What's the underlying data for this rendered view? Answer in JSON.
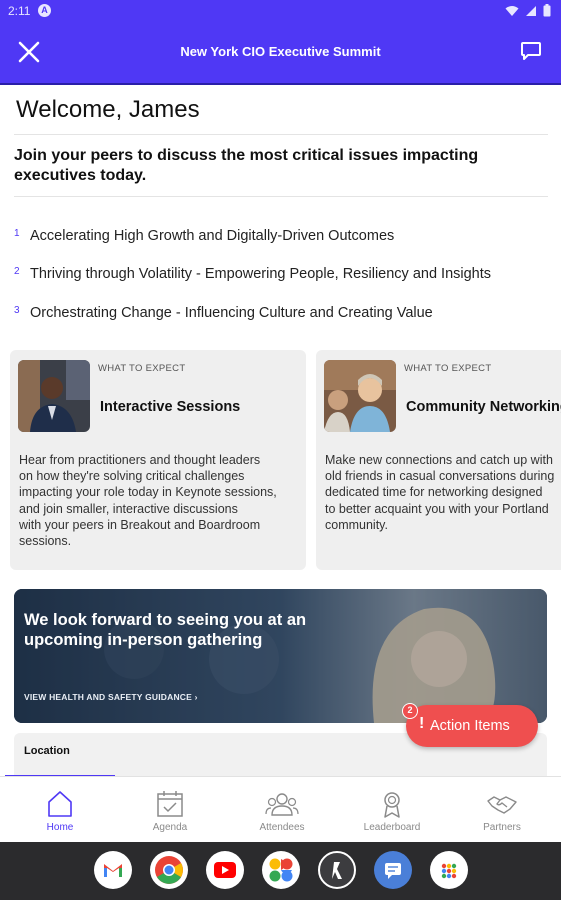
{
  "status_bar": {
    "time": "2:11",
    "badge": "A"
  },
  "header": {
    "title": "New York CIO Executive Summit",
    "close_icon": "close-icon",
    "chat_icon": "chat-icon",
    "color": "#4f38f5"
  },
  "welcome": "Welcome, James",
  "intro": "Join your peers to discuss the most critical issues impacting executives today.",
  "topics": [
    {
      "num": "1",
      "text": "Accelerating High Growth and Digitally-Driven Outcomes"
    },
    {
      "num": "2",
      "text": "Thriving through Volatility - Empowering People, Resiliency and Insights"
    },
    {
      "num": "3",
      "text": "Orchestrating Change - Influencing Culture and Creating Value"
    }
  ],
  "cards": [
    {
      "kicker": "WHAT TO EXPECT",
      "title": "Interactive Sessions",
      "body": [
        "Hear from practitioners and thought leaders",
        "on how they're solving critical challenges",
        "impacting your role today in Keynote sessions,",
        "and join smaller, interactive discussions",
        "with your peers in Breakout and Boardroom",
        "sessions."
      ]
    },
    {
      "kicker": "WHAT TO EXPECT",
      "title": "Community Networking",
      "body": [
        "Make new connections and catch up with",
        "old friends in casual conversations during",
        "dedicated time for networking designed",
        "to better acquaint you with your Portland",
        "community."
      ]
    }
  ],
  "banner": {
    "headline": "We look forward to seeing you at an upcoming in-person gathering",
    "link": "VIEW HEALTH AND SAFETY GUIDANCE ›"
  },
  "location_label": "Location",
  "action_items": {
    "label": "Action Items",
    "count": "2",
    "color": "#ef4f4f"
  },
  "nav": [
    {
      "label": "Home",
      "icon": "home-icon",
      "active": true
    },
    {
      "label": "Agenda",
      "icon": "calendar-check-icon",
      "active": false
    },
    {
      "label": "Attendees",
      "icon": "people-icon",
      "active": false
    },
    {
      "label": "Leaderboard",
      "icon": "medal-icon",
      "active": false
    },
    {
      "label": "Partners",
      "icon": "handshake-icon",
      "active": false
    }
  ],
  "dock_apps": [
    "gmail-icon",
    "chrome-icon",
    "youtube-icon",
    "photos-icon",
    "app-icon",
    "messages-icon",
    "app-drawer-icon"
  ]
}
